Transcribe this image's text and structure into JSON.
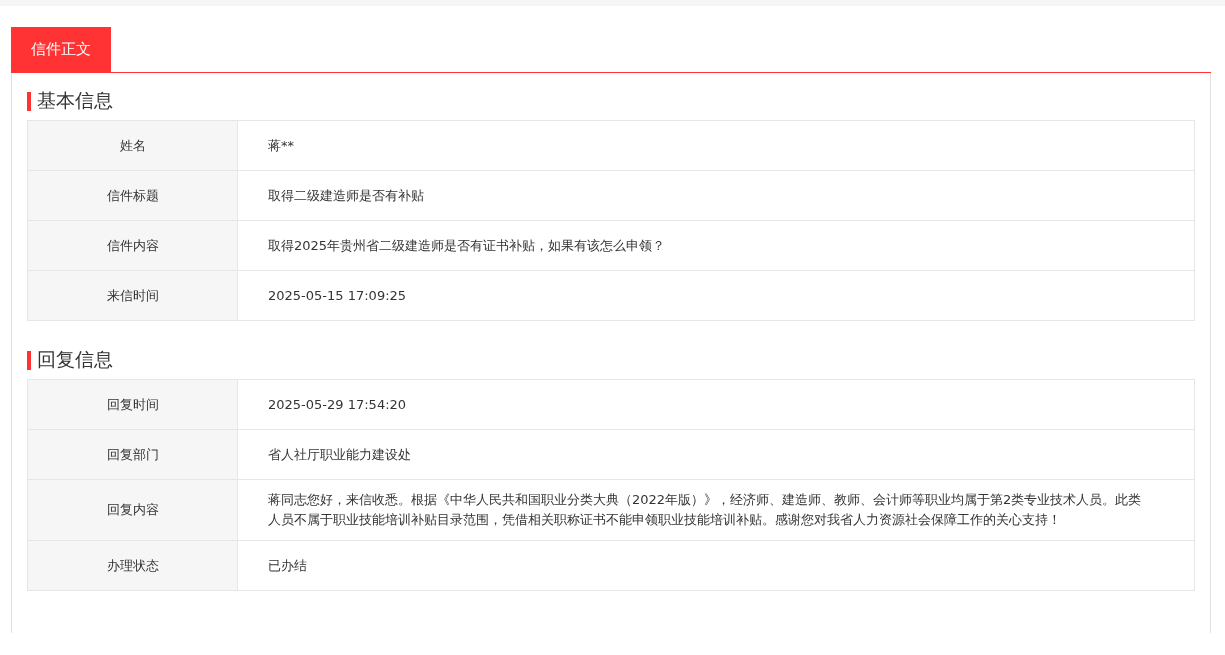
{
  "tabs": [
    {
      "label": "信件正文",
      "selected": true
    }
  ],
  "sections": [
    {
      "title": "基本信息",
      "rows": [
        {
          "label": "姓名",
          "value": "蒋**"
        },
        {
          "label": "信件标题",
          "value": "取得二级建造师是否有补贴"
        },
        {
          "label": "信件内容",
          "value": "取得2025年贵州省二级建造师是否有证书补贴，如果有该怎么申领？"
        },
        {
          "label": "来信时间",
          "value": "2025-05-15 17:09:25"
        }
      ]
    },
    {
      "title": "回复信息",
      "rows": [
        {
          "label": "回复时间",
          "value": "2025-05-29 17:54:20"
        },
        {
          "label": "回复部门",
          "value": "省人社厅职业能力建设处"
        },
        {
          "label": "回复内容",
          "value": "蒋同志您好，来信收悉。根据《中华人民共和国职业分类大典（2022年版）》，经济师、建造师、教师、会计师等职业均属于第2类专业技术人员。此类人员不属于职业技能培训补贴目录范围，凭借相关职称证书不能申领职业技能培训补贴。感谢您对我省人力资源社会保障工作的关心支持！"
        },
        {
          "label": "办理状态",
          "value": "已办结"
        }
      ]
    }
  ]
}
